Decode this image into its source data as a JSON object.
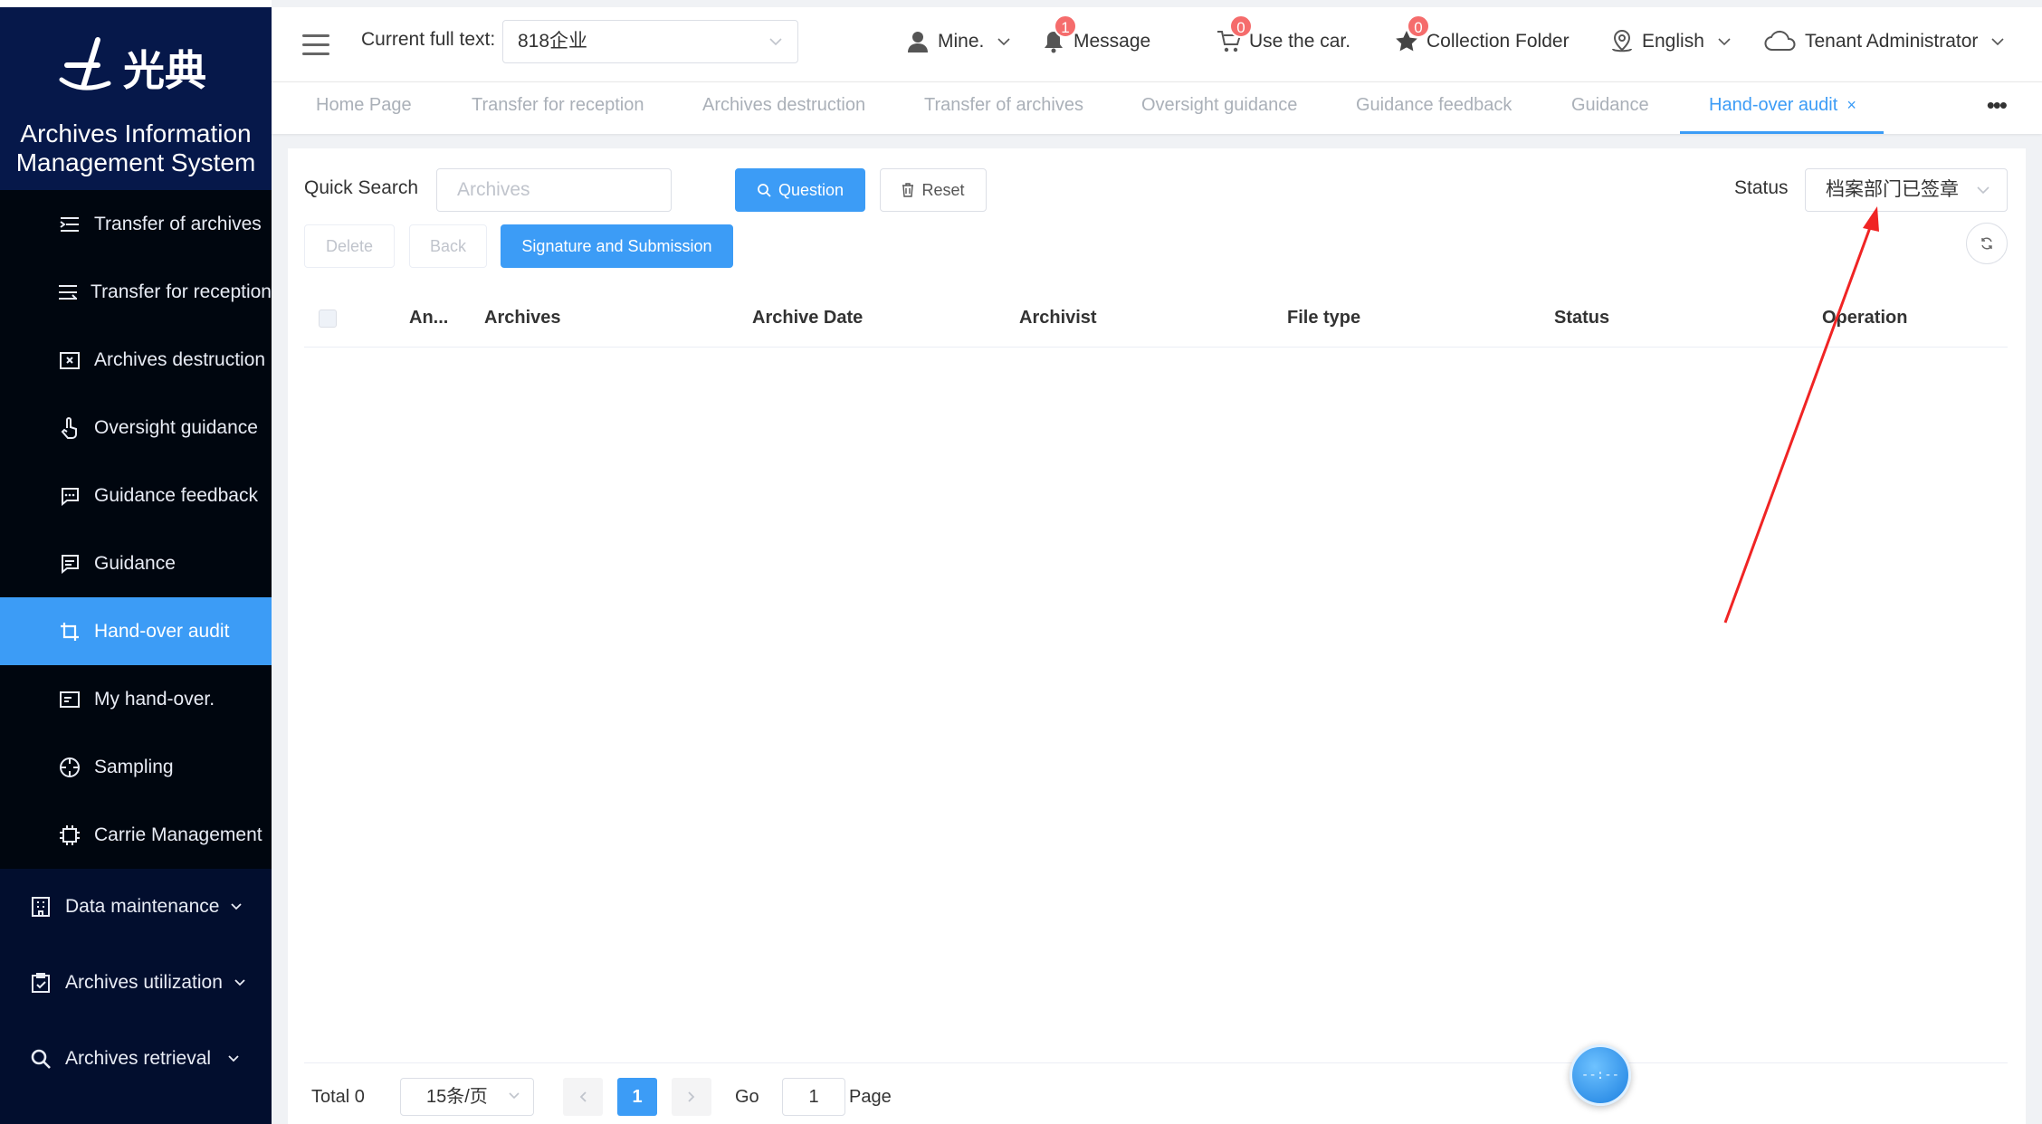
{
  "app": {
    "logo_text": "光典",
    "title": "Archives Information Management System"
  },
  "sidebar": {
    "items": [
      {
        "label": "Transfer of archives",
        "icon": "list-indent-icon"
      },
      {
        "label": "Transfer for reception",
        "icon": "list-icon"
      },
      {
        "label": "Archives destruction",
        "icon": "box-x-icon"
      },
      {
        "label": "Oversight guidance",
        "icon": "hand-pointer-icon"
      },
      {
        "label": "Guidance feedback",
        "icon": "chat-dots-icon"
      },
      {
        "label": "Guidance",
        "icon": "message-square-icon"
      },
      {
        "label": "Hand-over audit",
        "icon": "crop-icon",
        "active": true
      },
      {
        "label": "My hand-over.",
        "icon": "card-icon"
      },
      {
        "label": "Sampling",
        "icon": "crosshair-icon"
      },
      {
        "label": "Carrie Management",
        "icon": "chip-icon"
      }
    ],
    "groups": [
      {
        "label": "Data maintenance",
        "icon": "building-icon"
      },
      {
        "label": "Archives utilization",
        "icon": "clipboard-check-icon"
      },
      {
        "label": "Archives retrieval",
        "icon": "search-icon"
      }
    ]
  },
  "header": {
    "current_label": "Current full text:",
    "current_value": "818企业",
    "mine": "Mine.",
    "message": "Message",
    "message_badge": "1",
    "car": "Use the car.",
    "car_badge": "0",
    "collection": "Collection Folder",
    "collection_badge": "0",
    "language": "English",
    "user": "Tenant Administrator"
  },
  "tabs": [
    {
      "label": "Home Page"
    },
    {
      "label": "Transfer for reception"
    },
    {
      "label": "Archives destruction"
    },
    {
      "label": "Transfer of archives"
    },
    {
      "label": "Oversight guidance"
    },
    {
      "label": "Guidance feedback"
    },
    {
      "label": "Guidance"
    },
    {
      "label": "Hand-over audit",
      "active": true
    }
  ],
  "tab_close": "×",
  "tab_more": "•••",
  "search": {
    "label": "Quick Search",
    "placeholder": "Archives",
    "question_btn": "Question",
    "reset_btn": "Reset",
    "status_label": "Status",
    "status_value": "档案部门已签章"
  },
  "actions": {
    "delete": "Delete",
    "back": "Back",
    "sign_submit": "Signature and Submission"
  },
  "table": {
    "columns": [
      "An...",
      "Archives",
      "Archive Date",
      "Archivist",
      "File type",
      "Status",
      "Operation"
    ],
    "rows": []
  },
  "pager": {
    "total": "Total 0",
    "page_size": "15条/页",
    "current_page": "1",
    "go_label": "Go",
    "go_value": "1",
    "page_label": "Page"
  },
  "float_ball": "--:--",
  "colors": {
    "primary": "#3c9cf6",
    "sidebar_bg": "#020e2e",
    "badge": "#f56c6c",
    "annotation_arrow": "#f02424"
  }
}
